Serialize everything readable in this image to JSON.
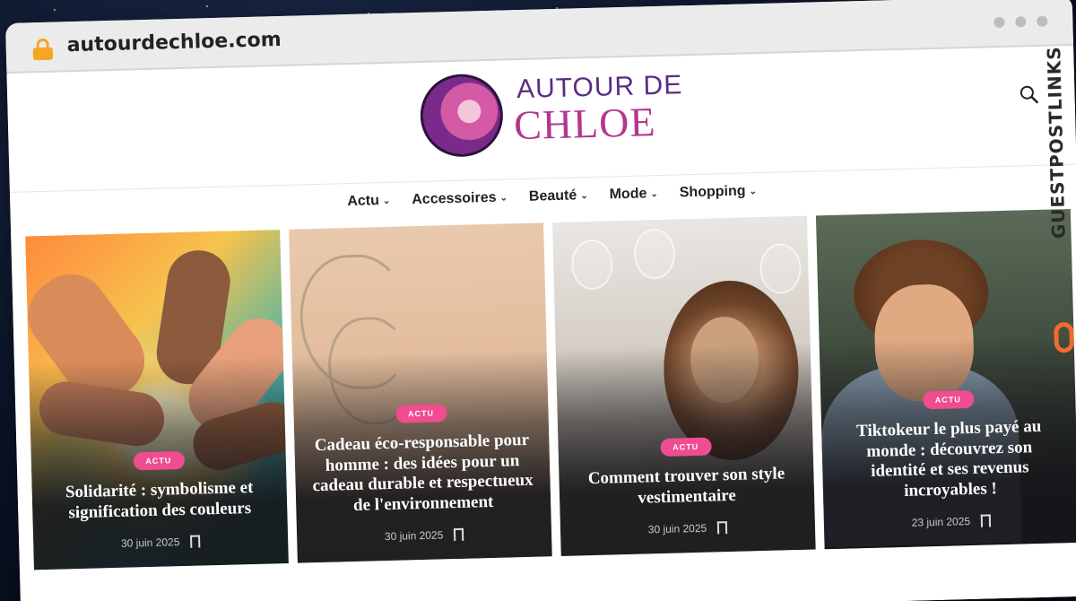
{
  "browser": {
    "url": "autourdechloe.com"
  },
  "site": {
    "logo": {
      "line1": "AUTOUR DE",
      "line2": "CHLOE"
    },
    "nav": [
      {
        "label": "Actu"
      },
      {
        "label": "Accessoires"
      },
      {
        "label": "Beauté"
      },
      {
        "label": "Mode"
      },
      {
        "label": "Shopping"
      }
    ],
    "articles": [
      {
        "badge": "ACTU",
        "title": "Solidarité : symbolisme et signification des couleurs",
        "date": "30 juin 2025"
      },
      {
        "badge": "ACTU",
        "title": "Cadeau éco-responsable pour homme : des idées pour un cadeau durable et respectueux de l'environnement",
        "date": "30 juin 2025"
      },
      {
        "badge": "ACTU",
        "title": "Comment trouver son style vestimentaire",
        "date": "30 juin 2025"
      },
      {
        "badge": "ACTU",
        "title": "Tiktokeur le plus payé au monde : découvrez son identité et ses revenus incroyables !",
        "date": "23 juin 2025"
      }
    ]
  },
  "watermark": {
    "text": "GUESTPOSTLINKS"
  },
  "colors": {
    "accent": "#ef4d8f",
    "logo_purple": "#5a2d82",
    "logo_pink": "#b4368f",
    "lock": "#f5a623"
  },
  "icons": {
    "lock": "lock-icon",
    "search": "search-icon",
    "bookmark": "bookmark-icon",
    "chevron": "chevron-down-icon"
  }
}
